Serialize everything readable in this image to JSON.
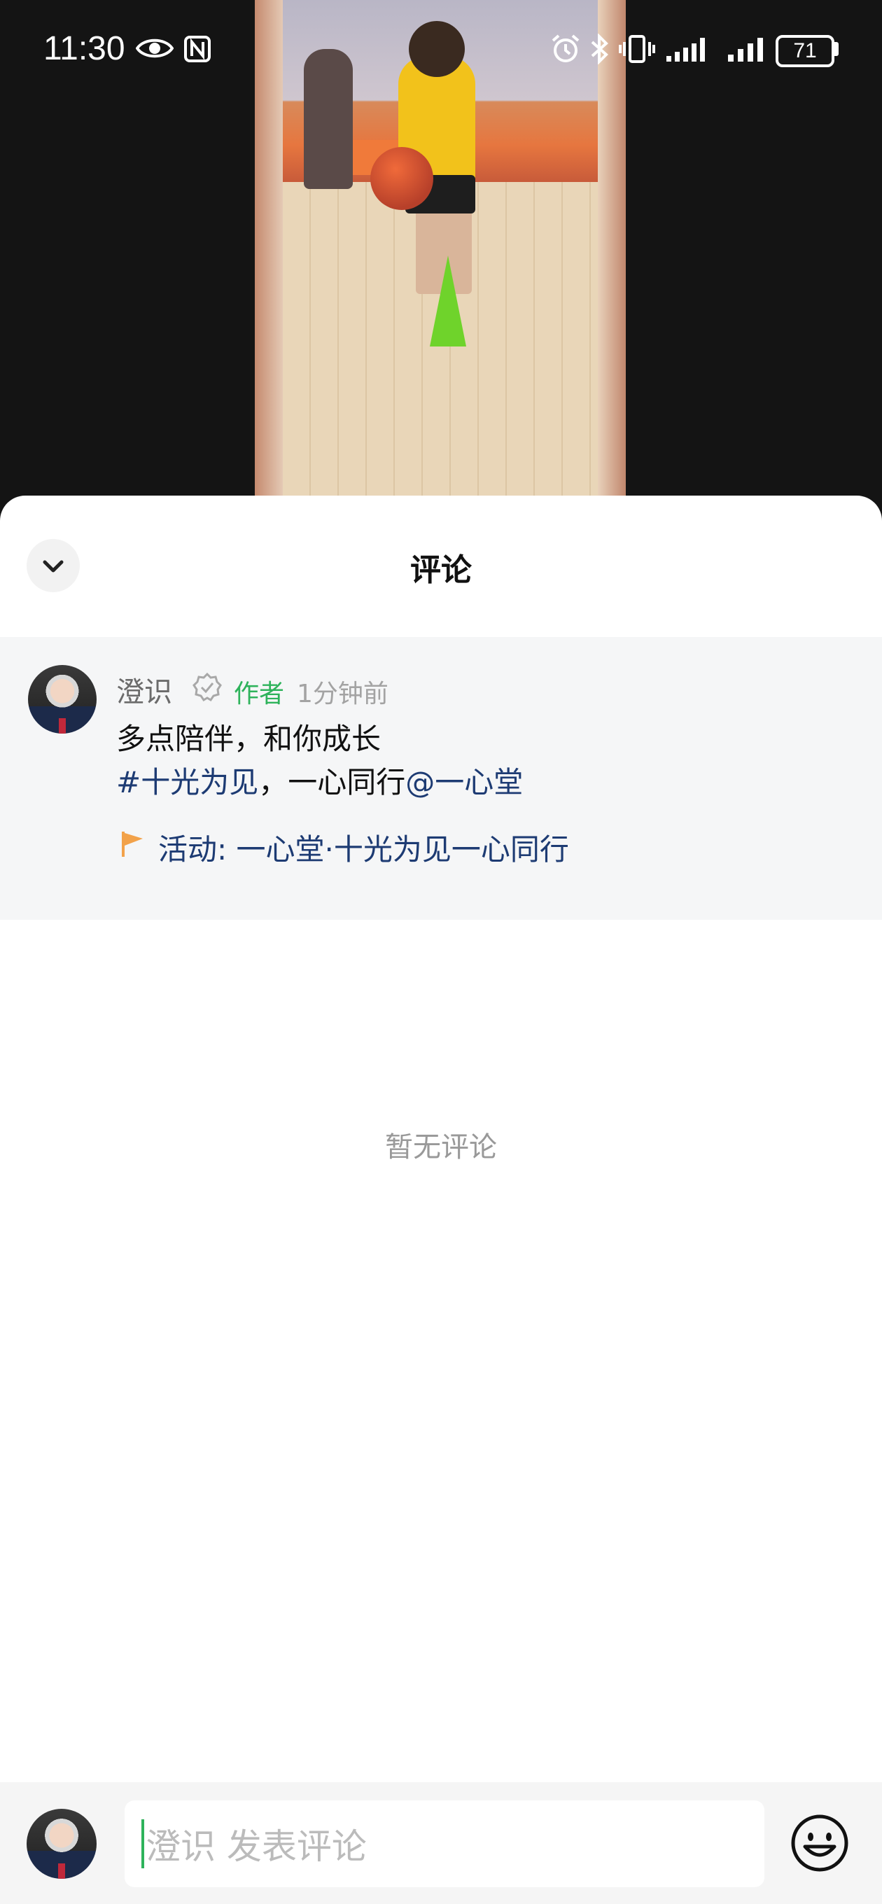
{
  "status_bar": {
    "time": "11:30",
    "battery": "71",
    "icons": [
      "eye-icon",
      "nfc-icon",
      "alarm-icon",
      "bluetooth-icon",
      "vibrate-icon",
      "signal-icon",
      "signal-icon",
      "battery-icon"
    ]
  },
  "sheet": {
    "title": "评论"
  },
  "post": {
    "author": "澄识",
    "author_tag": "作者",
    "time": "1分钟前",
    "line1": "多点陪伴，和你成长",
    "hashtag": "#十光为见",
    "line2_mid": "，一心同行",
    "mention": "@一心堂",
    "activity": "活动: 一心堂·十光为见一心同行"
  },
  "empty_text": "暂无评论",
  "input": {
    "placeholder": "澄识 发表评论"
  },
  "colors": {
    "accent_green": "#2eb35b",
    "link_blue": "#1d3b73",
    "flag_orange": "#f2a24a"
  }
}
